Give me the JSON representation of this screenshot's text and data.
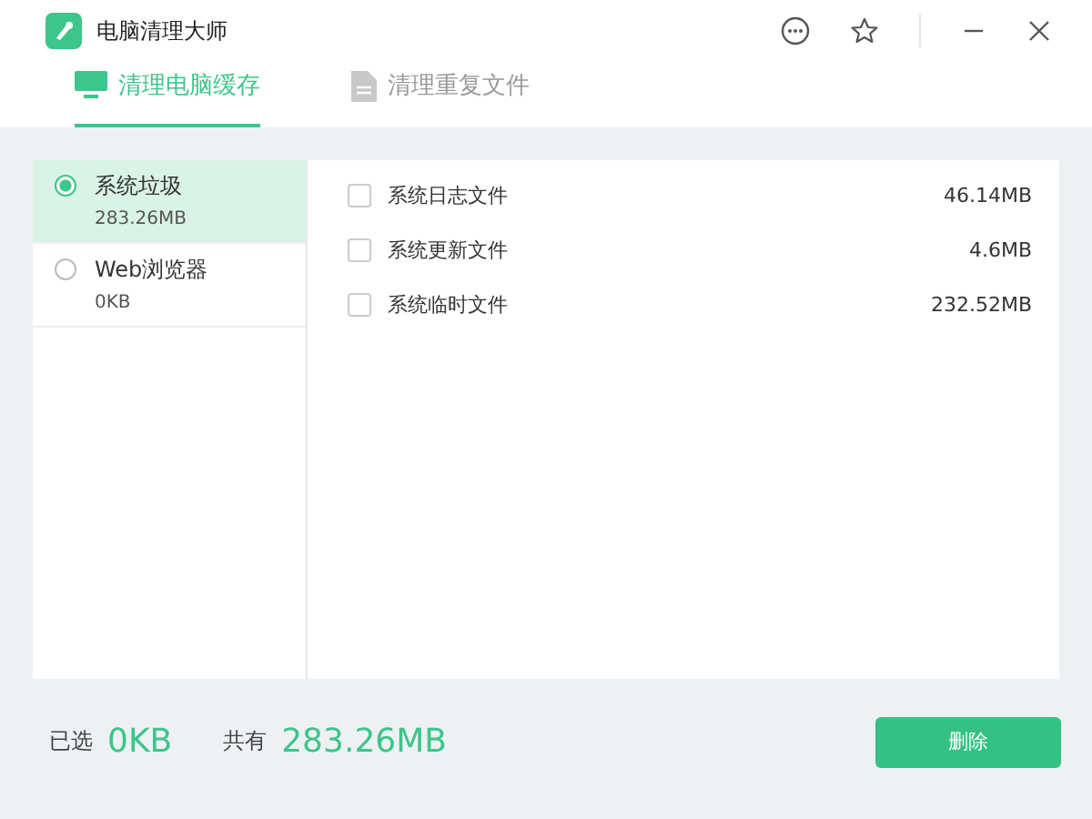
{
  "window": {
    "title": "电脑清理大师"
  },
  "tabs": [
    {
      "label": "清理电脑缓存",
      "selected": true
    },
    {
      "label": "清理重复文件",
      "selected": false
    }
  ],
  "categories": [
    {
      "name": "系统垃圾",
      "size": "283.26MB",
      "selected": true
    },
    {
      "name": "Web浏览器",
      "size": "0KB",
      "selected": false
    }
  ],
  "files": [
    {
      "name": "系统日志文件",
      "size": "46.14MB",
      "checked": false
    },
    {
      "name": "系统更新文件",
      "size": "4.6MB",
      "checked": false
    },
    {
      "name": "系统临时文件",
      "size": "232.52MB",
      "checked": false
    }
  ],
  "footer": {
    "selected_label": "已选",
    "selected_value": "0KB",
    "total_label": "共有",
    "total_value": "283.26MB",
    "button": "删除"
  }
}
